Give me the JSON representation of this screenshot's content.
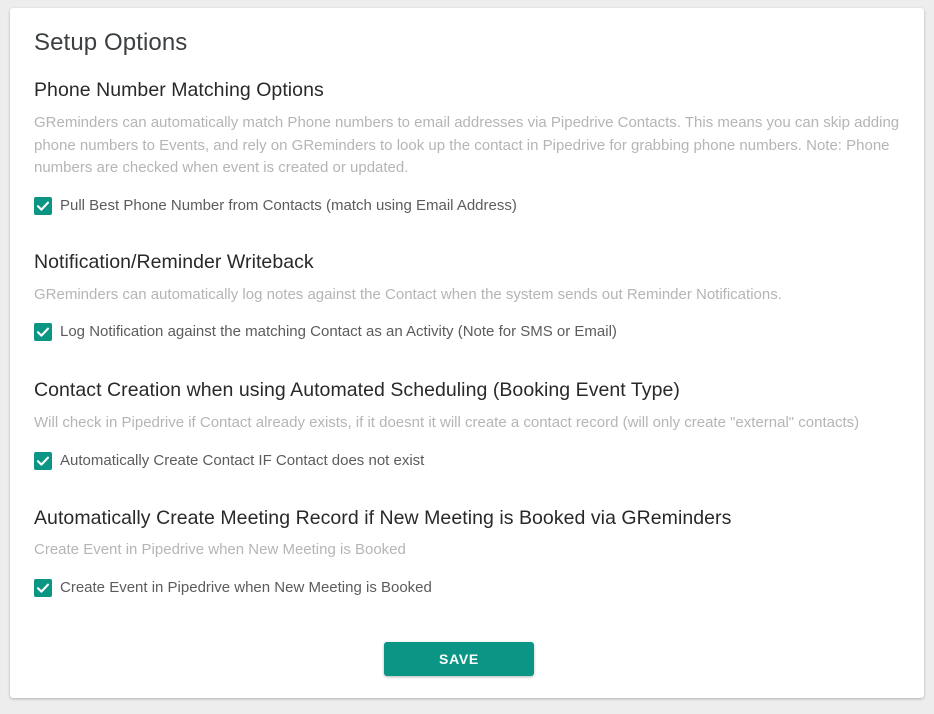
{
  "page": {
    "title": "Setup Options"
  },
  "theme": {
    "accent": "#0a9585",
    "card_background": "#ffffff",
    "page_background": "#ededed",
    "heading_color": "#28292b",
    "description_color": "#b5b5b5",
    "label_color": "#5c5c5c"
  },
  "sections": [
    {
      "heading": "Phone Number Matching Options",
      "description": "GReminders can automatically match Phone numbers to email addresses via Pipedrive Contacts. This means you can skip adding phone numbers to Events, and rely on GReminders to look up the contact in Pipedrive for grabbing phone numbers. Note: Phone numbers are checked when event is created or updated.",
      "checkbox": {
        "label": "Pull Best Phone Number from Contacts (match using Email Address)",
        "checked": true
      }
    },
    {
      "heading": "Notification/Reminder Writeback",
      "description": "GReminders can automatically log notes against the Contact when the system sends out Reminder Notifications.",
      "checkbox": {
        "label": "Log Notification against the matching Contact as an Activity (Note for SMS or Email)",
        "checked": true
      }
    },
    {
      "heading": "Contact Creation when using Automated Scheduling (Booking Event Type)",
      "description": "Will check in Pipedrive if Contact already exists, if it doesnt it will create a contact record (will only create \"external\" contacts)",
      "checkbox": {
        "label": "Automatically Create Contact IF Contact does not exist",
        "checked": true
      }
    },
    {
      "heading": "Automatically Create Meeting Record if New Meeting is Booked via GReminders",
      "description": "Create Event in Pipedrive when New Meeting is Booked",
      "checkbox": {
        "label": "Create Event in Pipedrive when New Meeting is Booked",
        "checked": true
      }
    }
  ],
  "actions": {
    "save_label": "SAVE"
  },
  "icons": {
    "checkmark": "check-icon"
  }
}
